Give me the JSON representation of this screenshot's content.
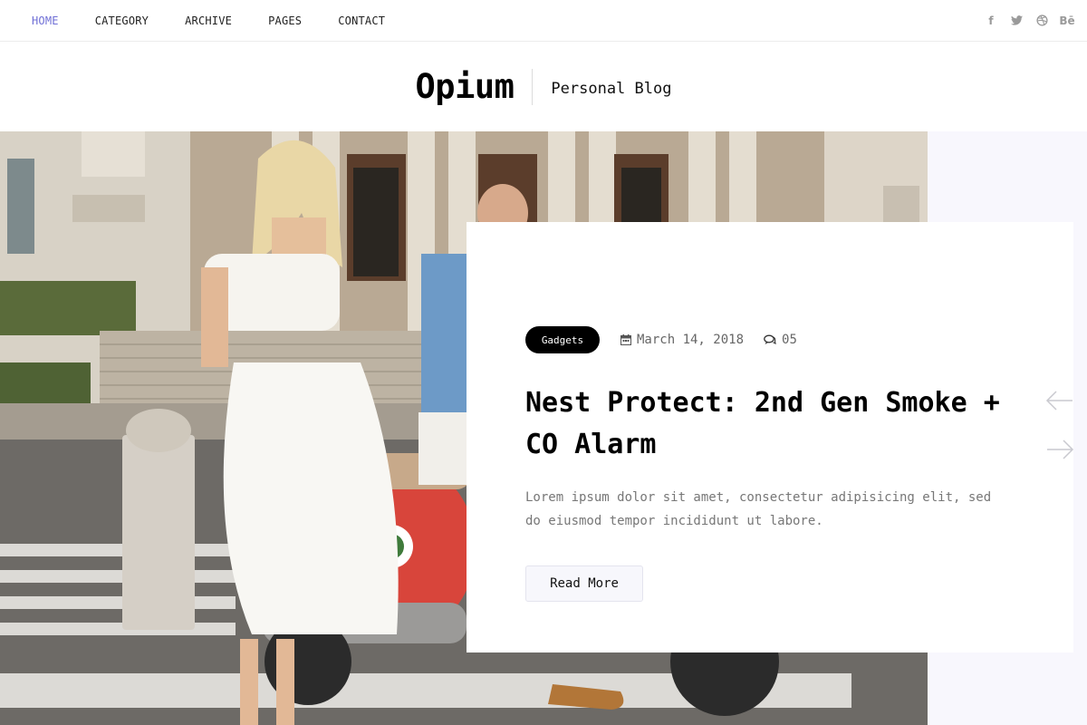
{
  "nav": {
    "items": [
      "HOME",
      "CATEGORY",
      "ARCHIVE",
      "PAGES",
      "CONTACT"
    ],
    "active_index": 0
  },
  "social": {
    "icons": [
      "facebook-icon",
      "twitter-icon",
      "dribbble-icon",
      "behance-icon"
    ],
    "labels": [
      "f",
      "",
      "",
      "Bē"
    ]
  },
  "header": {
    "brand": "Opium",
    "tagline": "Personal Blog"
  },
  "post": {
    "category": "Gadgets",
    "date": "March 14, 2018",
    "comments": "05",
    "title": "Nest Protect: 2nd Gen Smoke + CO Alarm",
    "excerpt": "Lorem ipsum dolor sit amet, consectetur adipisicing elit, sed do eiusmod tempor incididunt ut labore.",
    "read_more": "Read More"
  },
  "colors": {
    "accent_nav": "#6f6fd6",
    "hero_side_bg": "#f8f7fd",
    "badge_bg": "#000000"
  }
}
